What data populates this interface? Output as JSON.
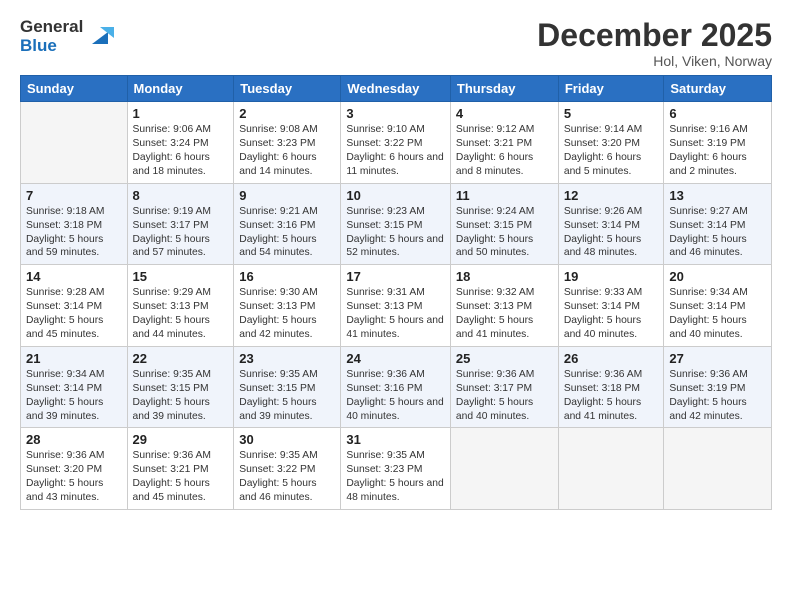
{
  "logo": {
    "general": "General",
    "blue": "Blue"
  },
  "header": {
    "month": "December 2025",
    "location": "Hol, Viken, Norway"
  },
  "weekdays": [
    "Sunday",
    "Monday",
    "Tuesday",
    "Wednesday",
    "Thursday",
    "Friday",
    "Saturday"
  ],
  "weeks": [
    [
      {
        "day": "",
        "empty": true
      },
      {
        "day": "1",
        "sunrise": "9:06 AM",
        "sunset": "3:24 PM",
        "daylight": "6 hours and 18 minutes."
      },
      {
        "day": "2",
        "sunrise": "9:08 AM",
        "sunset": "3:23 PM",
        "daylight": "6 hours and 14 minutes."
      },
      {
        "day": "3",
        "sunrise": "9:10 AM",
        "sunset": "3:22 PM",
        "daylight": "6 hours and 11 minutes."
      },
      {
        "day": "4",
        "sunrise": "9:12 AM",
        "sunset": "3:21 PM",
        "daylight": "6 hours and 8 minutes."
      },
      {
        "day": "5",
        "sunrise": "9:14 AM",
        "sunset": "3:20 PM",
        "daylight": "6 hours and 5 minutes."
      },
      {
        "day": "6",
        "sunrise": "9:16 AM",
        "sunset": "3:19 PM",
        "daylight": "6 hours and 2 minutes."
      }
    ],
    [
      {
        "day": "7",
        "sunrise": "9:18 AM",
        "sunset": "3:18 PM",
        "daylight": "5 hours and 59 minutes."
      },
      {
        "day": "8",
        "sunrise": "9:19 AM",
        "sunset": "3:17 PM",
        "daylight": "5 hours and 57 minutes."
      },
      {
        "day": "9",
        "sunrise": "9:21 AM",
        "sunset": "3:16 PM",
        "daylight": "5 hours and 54 minutes."
      },
      {
        "day": "10",
        "sunrise": "9:23 AM",
        "sunset": "3:15 PM",
        "daylight": "5 hours and 52 minutes."
      },
      {
        "day": "11",
        "sunrise": "9:24 AM",
        "sunset": "3:15 PM",
        "daylight": "5 hours and 50 minutes."
      },
      {
        "day": "12",
        "sunrise": "9:26 AM",
        "sunset": "3:14 PM",
        "daylight": "5 hours and 48 minutes."
      },
      {
        "day": "13",
        "sunrise": "9:27 AM",
        "sunset": "3:14 PM",
        "daylight": "5 hours and 46 minutes."
      }
    ],
    [
      {
        "day": "14",
        "sunrise": "9:28 AM",
        "sunset": "3:14 PM",
        "daylight": "5 hours and 45 minutes."
      },
      {
        "day": "15",
        "sunrise": "9:29 AM",
        "sunset": "3:13 PM",
        "daylight": "5 hours and 44 minutes."
      },
      {
        "day": "16",
        "sunrise": "9:30 AM",
        "sunset": "3:13 PM",
        "daylight": "5 hours and 42 minutes."
      },
      {
        "day": "17",
        "sunrise": "9:31 AM",
        "sunset": "3:13 PM",
        "daylight": "5 hours and 41 minutes."
      },
      {
        "day": "18",
        "sunrise": "9:32 AM",
        "sunset": "3:13 PM",
        "daylight": "5 hours and 41 minutes."
      },
      {
        "day": "19",
        "sunrise": "9:33 AM",
        "sunset": "3:14 PM",
        "daylight": "5 hours and 40 minutes."
      },
      {
        "day": "20",
        "sunrise": "9:34 AM",
        "sunset": "3:14 PM",
        "daylight": "5 hours and 40 minutes."
      }
    ],
    [
      {
        "day": "21",
        "sunrise": "9:34 AM",
        "sunset": "3:14 PM",
        "daylight": "5 hours and 39 minutes."
      },
      {
        "day": "22",
        "sunrise": "9:35 AM",
        "sunset": "3:15 PM",
        "daylight": "5 hours and 39 minutes."
      },
      {
        "day": "23",
        "sunrise": "9:35 AM",
        "sunset": "3:15 PM",
        "daylight": "5 hours and 39 minutes."
      },
      {
        "day": "24",
        "sunrise": "9:36 AM",
        "sunset": "3:16 PM",
        "daylight": "5 hours and 40 minutes."
      },
      {
        "day": "25",
        "sunrise": "9:36 AM",
        "sunset": "3:17 PM",
        "daylight": "5 hours and 40 minutes."
      },
      {
        "day": "26",
        "sunrise": "9:36 AM",
        "sunset": "3:18 PM",
        "daylight": "5 hours and 41 minutes."
      },
      {
        "day": "27",
        "sunrise": "9:36 AM",
        "sunset": "3:19 PM",
        "daylight": "5 hours and 42 minutes."
      }
    ],
    [
      {
        "day": "28",
        "sunrise": "9:36 AM",
        "sunset": "3:20 PM",
        "daylight": "5 hours and 43 minutes."
      },
      {
        "day": "29",
        "sunrise": "9:36 AM",
        "sunset": "3:21 PM",
        "daylight": "5 hours and 45 minutes."
      },
      {
        "day": "30",
        "sunrise": "9:35 AM",
        "sunset": "3:22 PM",
        "daylight": "5 hours and 46 minutes."
      },
      {
        "day": "31",
        "sunrise": "9:35 AM",
        "sunset": "3:23 PM",
        "daylight": "5 hours and 48 minutes."
      },
      {
        "day": "",
        "empty": true
      },
      {
        "day": "",
        "empty": true
      },
      {
        "day": "",
        "empty": true
      }
    ]
  ]
}
